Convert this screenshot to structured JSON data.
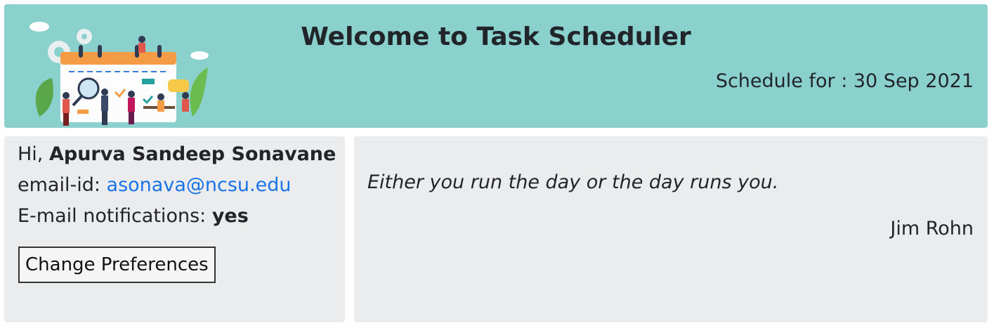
{
  "header": {
    "title": "Welcome to Task Scheduler",
    "schedule_label": "Schedule for : 30 Sep 2021",
    "illustration_icon": "calendar-team-illustration",
    "bg_color": "#8ad1cd"
  },
  "user": {
    "greeting": "Hi,",
    "name": "Apurva Sandeep Sonavane",
    "email_label": "email-id:",
    "email": "asonava@ncsu.edu",
    "notifications_label": "E-mail notifications:",
    "notifications_value": "yes",
    "change_prefs_label": "Change Preferences"
  },
  "quote": {
    "text": "Either you run the day or the day runs you.",
    "author": "Jim Rohn"
  },
  "colors": {
    "panel": "#ebecee",
    "link": "#1a73e8"
  }
}
